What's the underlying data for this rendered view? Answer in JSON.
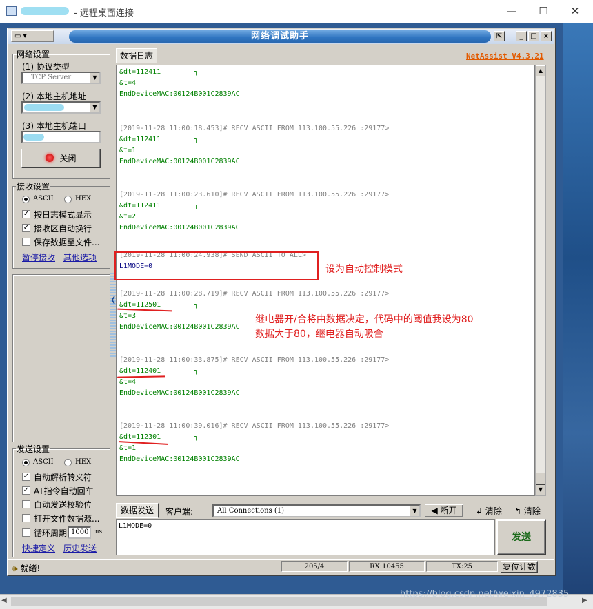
{
  "outer_window": {
    "title": "- 远程桌面连接",
    "minimize": "—",
    "maximize": "☐",
    "close": "✕"
  },
  "app": {
    "title": "网络调试助手",
    "version": "NetAssist V4.3.21",
    "title_buttons": {
      "pin": "⇱",
      "minimize": "_",
      "maximize": "□",
      "close": "×"
    },
    "sysmenu": "▾",
    "network": {
      "legend": "网络设置",
      "protocol_label": "(1) 协议类型",
      "protocol_value": "TCP Server",
      "host_label": "(2) 本地主机地址",
      "port_label": "(3) 本地主机端口",
      "close_button": "关闭"
    },
    "receive": {
      "legend": "接收设置",
      "ascii": "ASCII",
      "hex": "HEX",
      "opt1": "按日志模式显示",
      "opt2": "接收区自动换行",
      "opt3": "保存数据至文件...",
      "link1": "暂停接收",
      "link2": "其他选项"
    },
    "send_settings": {
      "legend": "发送设置",
      "ascii": "ASCII",
      "hex": "HEX",
      "opt1": "自动解析转义符",
      "opt2": "AT指令自动回车",
      "opt3": "自动发送校验位",
      "opt4": "打开文件数据源...",
      "opt5": "循环周期",
      "period": "1000",
      "unit": "ms",
      "link1": "快捷定义",
      "link2": "历史发送"
    },
    "log_tab": "数据日志",
    "log": [
      {
        "lines": [
          {
            "t": "&dt=112411        ┐",
            "c": "dat"
          },
          {
            "t": "&t=4",
            "c": "dat"
          },
          {
            "t": "EndDeviceMAC:00124B001C2839AC",
            "c": "dat"
          }
        ]
      },
      {
        "lines": [
          {
            "t": "[2019-11-28 11:00:18.453]# RECV ASCII FROM 113.100.55.226 :29177>",
            "c": "hdr"
          },
          {
            "t": "&dt=112411        ┐",
            "c": "dat"
          },
          {
            "t": "&t=1",
            "c": "dat"
          },
          {
            "t": "EndDeviceMAC:00124B001C2839AC",
            "c": "dat"
          }
        ]
      },
      {
        "lines": [
          {
            "t": "[2019-11-28 11:00:23.610]# RECV ASCII FROM 113.100.55.226 :29177>",
            "c": "hdr"
          },
          {
            "t": "&dt=112411        ┐",
            "c": "dat"
          },
          {
            "t": "&t=2",
            "c": "dat"
          },
          {
            "t": "EndDeviceMAC:00124B001C2839AC",
            "c": "dat"
          }
        ]
      },
      {
        "lines": [
          {
            "t": "[2019-11-28 11:00:24.938]# SEND ASCII TO ALL>",
            "c": "hdr"
          },
          {
            "t": "L1MODE=0",
            "c": "snd"
          }
        ]
      },
      {
        "lines": [
          {
            "t": "[2019-11-28 11:00:28.719]# RECV ASCII FROM 113.100.55.226 :29177>",
            "c": "hdr"
          },
          {
            "t": "&dt=112501        ┐",
            "c": "dat"
          },
          {
            "t": "&t=3",
            "c": "dat"
          },
          {
            "t": "EndDeviceMAC:00124B001C2839AC",
            "c": "dat"
          }
        ]
      },
      {
        "lines": [
          {
            "t": "[2019-11-28 11:00:33.875]# RECV ASCII FROM 113.100.55.226 :29177>",
            "c": "hdr"
          },
          {
            "t": "&dt=112401        ┐",
            "c": "dat"
          },
          {
            "t": "&t=4",
            "c": "dat"
          },
          {
            "t": "EndDeviceMAC:00124B001C2839AC",
            "c": "dat"
          }
        ]
      },
      {
        "lines": [
          {
            "t": "[2019-11-28 11:00:39.016]# RECV ASCII FROM 113.100.55.226 :29177>",
            "c": "hdr"
          },
          {
            "t": "&dt=112301        ┐",
            "c": "dat"
          },
          {
            "t": "&t=1",
            "c": "dat"
          },
          {
            "t": "EndDeviceMAC:00124B001C2839AC",
            "c": "dat"
          }
        ]
      }
    ],
    "annotations": {
      "mode_note": "设为自动控制模式",
      "relay_note": "继电器开/合将由数据决定，代码中的阈值我设为80\n数据大于80，继电器自动吸合"
    },
    "send_bar": {
      "tab": "数据发送",
      "client_label": "客户端:",
      "connection": "All Connections (1)",
      "disconnect": "断开",
      "clear1": "清除",
      "clear2": "清除",
      "input_value": "L1MODE=0",
      "send_button": "发送"
    },
    "status": {
      "ready": "就绪!",
      "counts": "205/4",
      "rx": "RX:10455",
      "tx": "TX:25",
      "reset": "复位计数"
    }
  },
  "watermark": "https://blog.csdn.net/weixin_4972835"
}
